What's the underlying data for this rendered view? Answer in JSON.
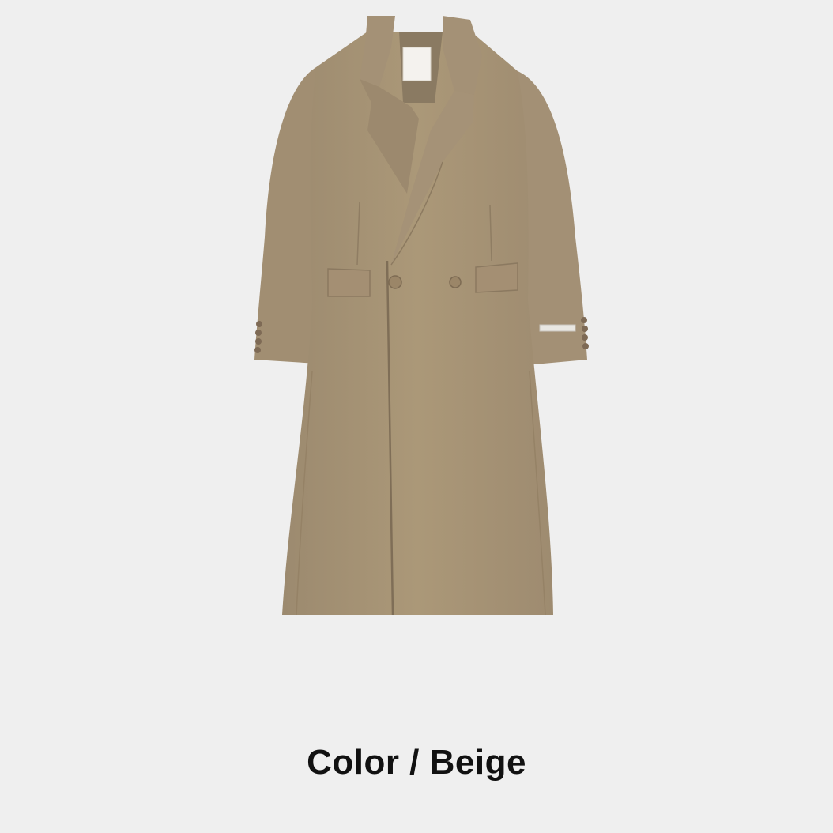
{
  "product": {
    "image_subject": "coat-photo",
    "caption": "Color / Beige",
    "colors": {
      "background": "#efefef",
      "coat": "#a89478",
      "coat_shadow": "#8d7b62",
      "coat_highlight": "#b5a286",
      "caption_text": "#111111"
    }
  }
}
